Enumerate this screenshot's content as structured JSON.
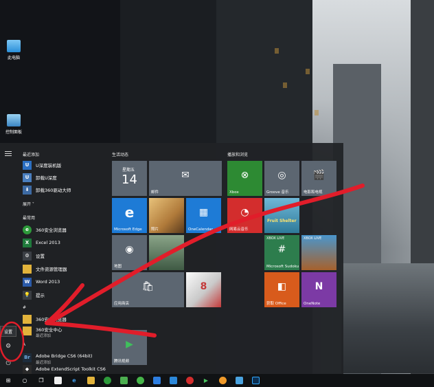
{
  "desktop": {
    "icons": [
      {
        "label": "此电脑"
      },
      {
        "label": "控制面板"
      }
    ]
  },
  "start_menu": {
    "recent_header": "最近添加",
    "recent_apps": [
      {
        "label": "U深度装机版"
      },
      {
        "label": "卸载U深度"
      },
      {
        "label": "卸载360驱动大师"
      }
    ],
    "expand_label": "展开 ˅",
    "most_used_header": "最常用",
    "most_used_apps": [
      {
        "label": "360安全浏览器"
      },
      {
        "label": "Excel 2013"
      },
      {
        "label": "设置"
      },
      {
        "label": "文件资源管理器"
      },
      {
        "label": "Word 2013"
      },
      {
        "label": "提示"
      }
    ],
    "alpha_header": "#",
    "alpha_apps": [
      {
        "label": "360安全浏览器"
      },
      {
        "label": "360安全中心",
        "sub": "最近添加"
      }
    ],
    "a_header": "A",
    "a_apps": [
      {
        "label": "Adobe Bridge CS6 (64bit)",
        "sub": "最近添加"
      },
      {
        "label": "Adobe ExtendScript Toolkit CS6"
      }
    ],
    "settings_tooltip": "设置",
    "group_life": "生活动态",
    "group_play": "播放和浏览",
    "calendar": {
      "day": "星期五",
      "date": "14"
    },
    "tiles_life": [
      {
        "label": "邮件"
      },
      {
        "label": "Microsoft Edge"
      },
      {
        "label": "照片"
      },
      {
        "label": "OneCalendar"
      },
      {
        "label": "地图"
      },
      {
        "label": "应用商店"
      },
      {
        "label": "腾讯视频"
      }
    ],
    "tiles_play": [
      {
        "label": "Xbox"
      },
      {
        "label": "Groove 音乐"
      },
      {
        "label": "电影和电视"
      },
      {
        "label": "网易云音乐"
      },
      {
        "label": "Microsoft Sudoku"
      },
      {
        "label": "获取 Office"
      },
      {
        "label": "OneNote"
      }
    ],
    "tile_text": {
      "xbox_live": "XBOX LIVE",
      "fruit": "Fruit Shelter"
    }
  },
  "colors": {
    "tile_blue": "#1e7bd6",
    "tile_gray": "#5c6671",
    "tile_green": "#2d8a33",
    "tile_red": "#d32d2d",
    "tile_orange": "#d85b1c",
    "tile_purple": "#7c3aa5",
    "annotation": "#e11d2a"
  }
}
